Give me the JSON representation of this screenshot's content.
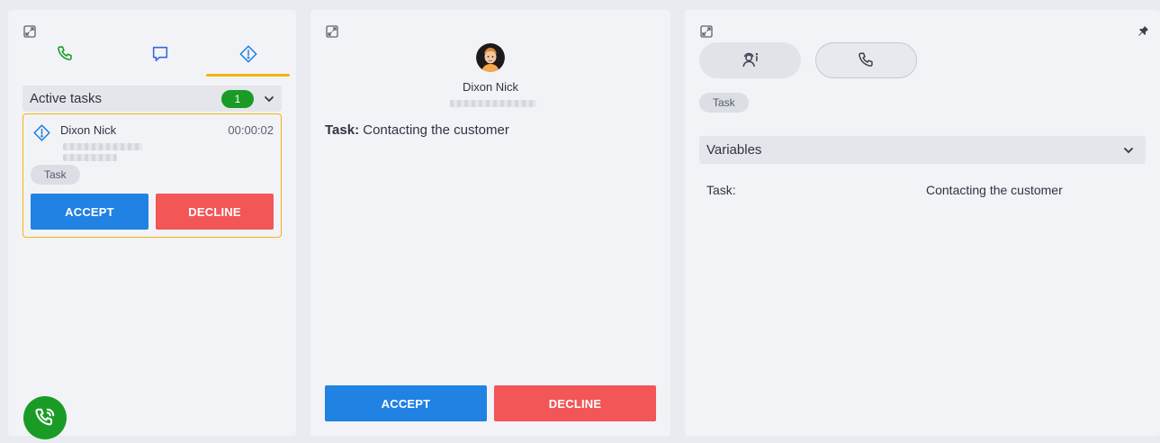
{
  "left_panel": {
    "tabs": [
      {
        "icon": "phone-icon",
        "color": "#1a9b25"
      },
      {
        "icon": "chat-icon",
        "color": "#3d63dd"
      },
      {
        "icon": "task-alert-icon",
        "color": "#2082e2",
        "active": true
      }
    ],
    "section_title": "Active tasks",
    "task_count": "1",
    "task_card": {
      "name": "Dixon Nick",
      "timer": "00:00:02",
      "chip": "Task",
      "accept_label": "ACCEPT",
      "decline_label": "DECLINE"
    }
  },
  "middle_panel": {
    "contact_name": "Dixon Nick",
    "task_label": "Task:",
    "task_value": "Contacting the customer",
    "accept_label": "ACCEPT",
    "decline_label": "DECLINE"
  },
  "right_panel": {
    "chip": "Task",
    "variables_title": "Variables",
    "variables": [
      {
        "key": "Task:",
        "value": "Contacting the customer"
      }
    ]
  },
  "colors": {
    "accent_orange": "#f4b40f",
    "accept_blue": "#2082e2",
    "decline_red": "#f25657",
    "badge_green": "#1a9b25"
  }
}
